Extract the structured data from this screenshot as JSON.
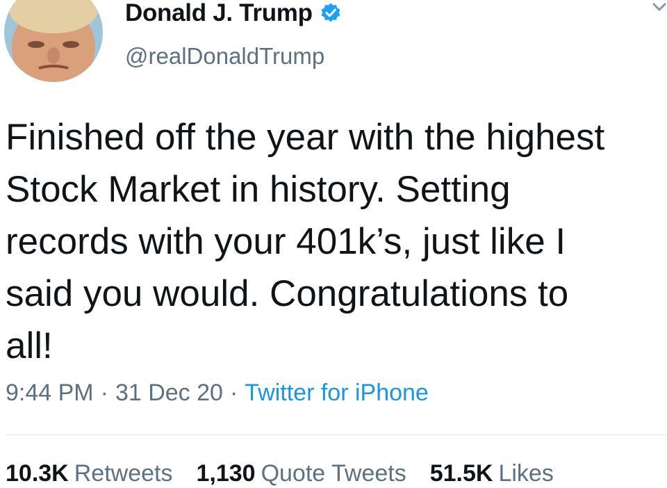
{
  "author": {
    "display_name": "Donald J. Trump",
    "handle": "@realDonaldTrump",
    "verified": true
  },
  "tweet": {
    "text": "Finished off the year with the highest\nStock Market in history. Setting\nrecords with your 401k’s, just like I\nsaid you would. Congratulations to\nall!",
    "time": "9:44 PM",
    "date": "31 Dec 20",
    "separator": "·",
    "source": "Twitter for iPhone"
  },
  "stats": {
    "retweets_count": "10.3K",
    "retweets_label": "Retweets",
    "quotes_count": "1,130",
    "quotes_label": "Quote Tweets",
    "likes_count": "51.5K",
    "likes_label": "Likes"
  },
  "icons": {
    "verified": "verified-badge-icon",
    "menu": "chevron-down-icon",
    "avatar": "profile-photo"
  },
  "colors": {
    "text_primary": "#0f1419",
    "text_secondary": "#5b7083",
    "link": "#1b95e0",
    "verified": "#1da1f2",
    "divider": "#dfe5ea"
  }
}
